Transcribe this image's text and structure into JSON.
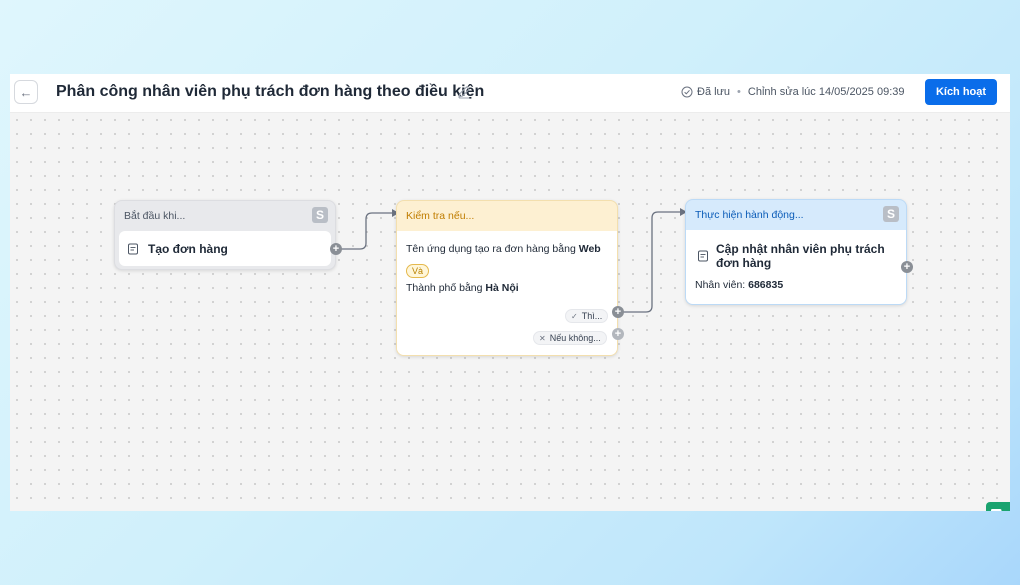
{
  "header": {
    "title": "Phân công nhân viên phụ trách đơn hàng theo điều kiện",
    "save_status": "Đã lưu",
    "edited_at": "Chỉnh sửa lúc 14/05/2025 09:39",
    "activate_label": "Kích hoạt"
  },
  "nodes": {
    "trigger": {
      "header": "Bắt đầu khi...",
      "badge": "S",
      "label": "Tạo đơn hàng"
    },
    "condition": {
      "header": "Kiểm tra nếu...",
      "cond1_prefix": "Tên ứng dụng tạo ra đơn hàng bằng",
      "cond1_value": "Web",
      "and_label": "Và",
      "cond2_prefix": "Thành phố bằng",
      "cond2_value": "Hà Nội",
      "branch_true": "Thì...",
      "branch_false": "Nếu không..."
    },
    "action": {
      "header": "Thực hiện hành động...",
      "badge": "S",
      "title": "Cập nhật nhân viên phụ trách đơn hàng",
      "detail_label": "Nhân viên:",
      "detail_value": "686835"
    }
  },
  "colors": {
    "primary": "#0a6dea",
    "trigger_head": "#e8e9ec",
    "condition_head": "#fdf0d2",
    "condition_head_text": "#c07d00",
    "action_head": "#d6eafc",
    "action_head_text": "#0b5cb8",
    "chat": "#1aa36f"
  },
  "icons": {
    "back": "arrow-left-icon",
    "edit": "pencil-icon",
    "saved": "check-circle-icon",
    "node_item": "document-icon",
    "add": "plus-circle-icon",
    "chat": "chat-icon"
  }
}
